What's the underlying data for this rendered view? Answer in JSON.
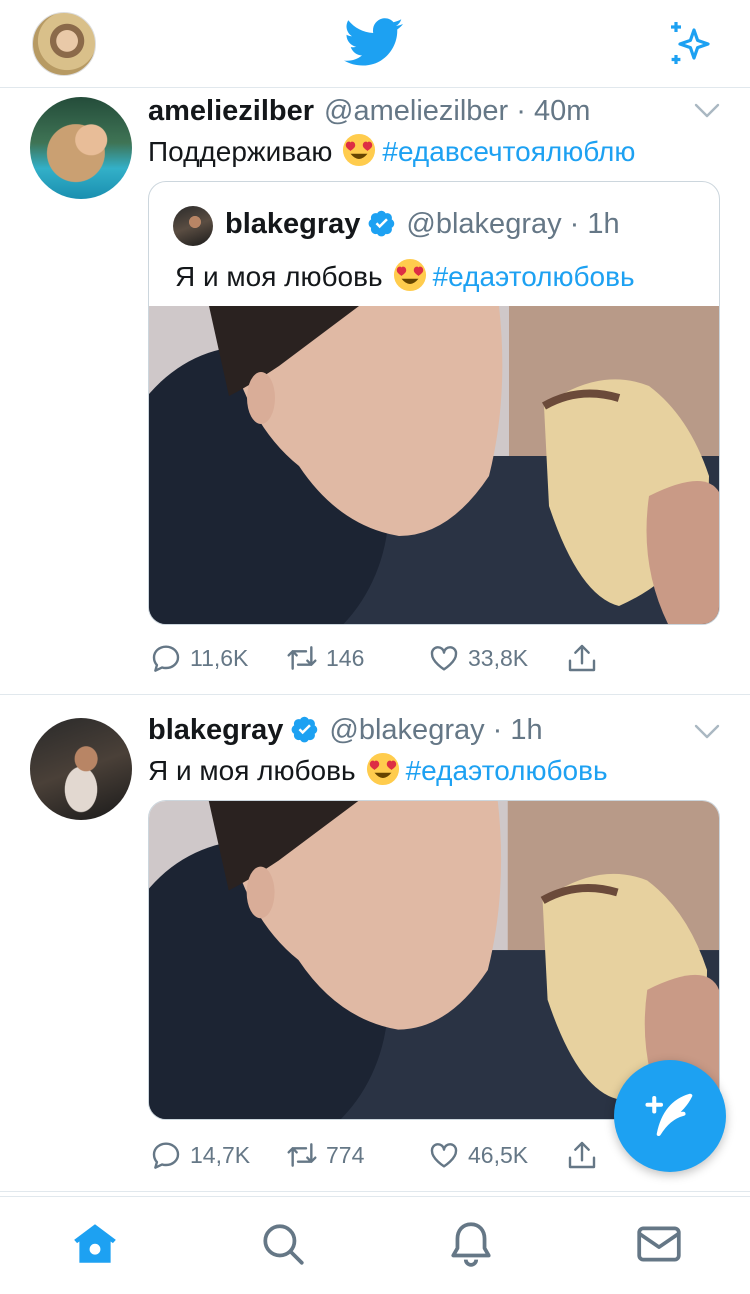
{
  "colors": {
    "accent": "#1da1f2",
    "text": "#14171a",
    "muted": "#657786",
    "border": "#e1e8ed"
  },
  "header": {
    "logo_icon": "twitter-bird-icon",
    "sparkle_icon": "sparkle-icon"
  },
  "tweets": [
    {
      "name": "ameliezilber",
      "handle": "@ameliezilber",
      "dot": " · ",
      "time": "40m",
      "text": "Поддерживаю",
      "hashtag": "#едавсечтоялюблю",
      "quote": {
        "name": "blakegray",
        "handle": "@blakegray",
        "dot": " · ",
        "time": "1h",
        "text": "Я и моя любовь",
        "hashtag": "#едаэтолюбовь"
      },
      "replies": "11,6K",
      "retweets": "146",
      "likes": "33,8K"
    },
    {
      "name": "blakegray",
      "handle": "@blakegray",
      "dot": " · ",
      "time": "1h",
      "text": "Я и моя любовь",
      "hashtag": "#едаэтолюбовь",
      "replies": "14,7K",
      "retweets": "774",
      "likes": "46,5K"
    }
  ],
  "tabs": [
    "home-icon",
    "search-icon",
    "bell-icon",
    "mail-icon"
  ]
}
